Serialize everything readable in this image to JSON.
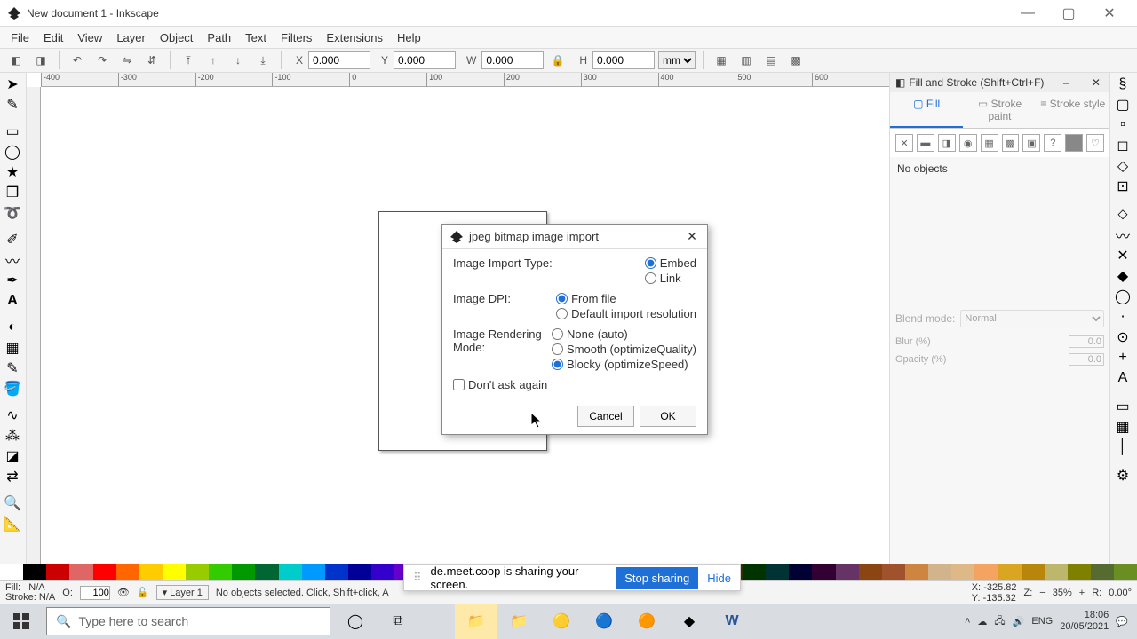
{
  "window": {
    "title": "New document 1 - Inkscape",
    "app_name": "Inkscape"
  },
  "menu": [
    "File",
    "Edit",
    "View",
    "Layer",
    "Object",
    "Path",
    "Text",
    "Filters",
    "Extensions",
    "Help"
  ],
  "toolbar": {
    "x_label": "X",
    "x_val": "0.000",
    "y_label": "Y",
    "y_val": "0.000",
    "w_label": "W",
    "w_val": "0.000",
    "h_label": "H",
    "h_val": "0.000",
    "unit": "mm"
  },
  "ruler_ticks": [
    "-400",
    "-300",
    "-200",
    "-100",
    "0",
    "100",
    "200",
    "300",
    "400",
    "500",
    "600"
  ],
  "fillstroke": {
    "title": "Fill and Stroke (Shift+Ctrl+F)",
    "tabs": {
      "fill": "Fill",
      "stroke_paint": "Stroke paint",
      "stroke_style": "Stroke style"
    },
    "no_objects": "No objects",
    "blend_label": "Blend mode:",
    "blend_value": "Normal",
    "blur_label": "Blur (%)",
    "blur_val": "0.0",
    "opacity_label": "Opacity (%)",
    "opacity_val": "0.0"
  },
  "dialog": {
    "title": "jpeg bitmap image import",
    "import_type_label": "Image Import Type:",
    "import_type": {
      "embed": "Embed",
      "link": "Link",
      "selected": "embed"
    },
    "dpi_label": "Image DPI:",
    "dpi": {
      "from_file": "From file",
      "default": "Default import resolution",
      "selected": "from_file"
    },
    "rendering_label": "Image Rendering Mode:",
    "rendering": {
      "none": "None (auto)",
      "smooth": "Smooth (optimizeQuality)",
      "blocky": "Blocky (optimizeSpeed)",
      "selected": "blocky"
    },
    "dont_ask": "Don't ask again",
    "cancel": "Cancel",
    "ok": "OK"
  },
  "palette_colors": [
    "#ffffff",
    "#000000",
    "#cc0000",
    "#e06666",
    "#ff0000",
    "#ff6600",
    "#ffcc00",
    "#ffff00",
    "#99cc00",
    "#33cc00",
    "#009900",
    "#006633",
    "#00cccc",
    "#0099ff",
    "#0033cc",
    "#000099",
    "#3300cc",
    "#6600cc",
    "#9900cc",
    "#cc00cc",
    "#ff00ff",
    "#ff0099",
    "#cc6666",
    "#996633",
    "#663300",
    "#333333",
    "#666666",
    "#999999",
    "#cccccc",
    "#990000",
    "#660000",
    "#333300",
    "#003300",
    "#003333",
    "#000033",
    "#330033",
    "#663366",
    "#8b4513",
    "#a0522d",
    "#cd853f",
    "#d2b48c",
    "#deb887",
    "#f4a460",
    "#daa520",
    "#b8860b",
    "#bdb76b",
    "#808000",
    "#556b2f",
    "#6b8e23"
  ],
  "statusbar": {
    "fill_label": "Fill:",
    "fill_val": "N/A",
    "stroke_label": "Stroke:",
    "stroke_val": "N/A",
    "o_label": "O:",
    "o_val": "100",
    "layer": "Layer 1",
    "hint": "No objects selected. Click, Shift+click, A",
    "x_label": "X:",
    "x_val": "-325.82",
    "y_label": "Y:",
    "y_val": "-135.32",
    "zoom": "35%",
    "z_label": "Z:",
    "rotation": "0.00°",
    "r_label": "R:"
  },
  "share": {
    "text": "de.meet.coop is sharing your screen.",
    "stop": "Stop sharing",
    "hide": "Hide"
  },
  "taskbar": {
    "search_placeholder": "Type here to search",
    "time": "18:06",
    "date": "20/05/2021"
  }
}
